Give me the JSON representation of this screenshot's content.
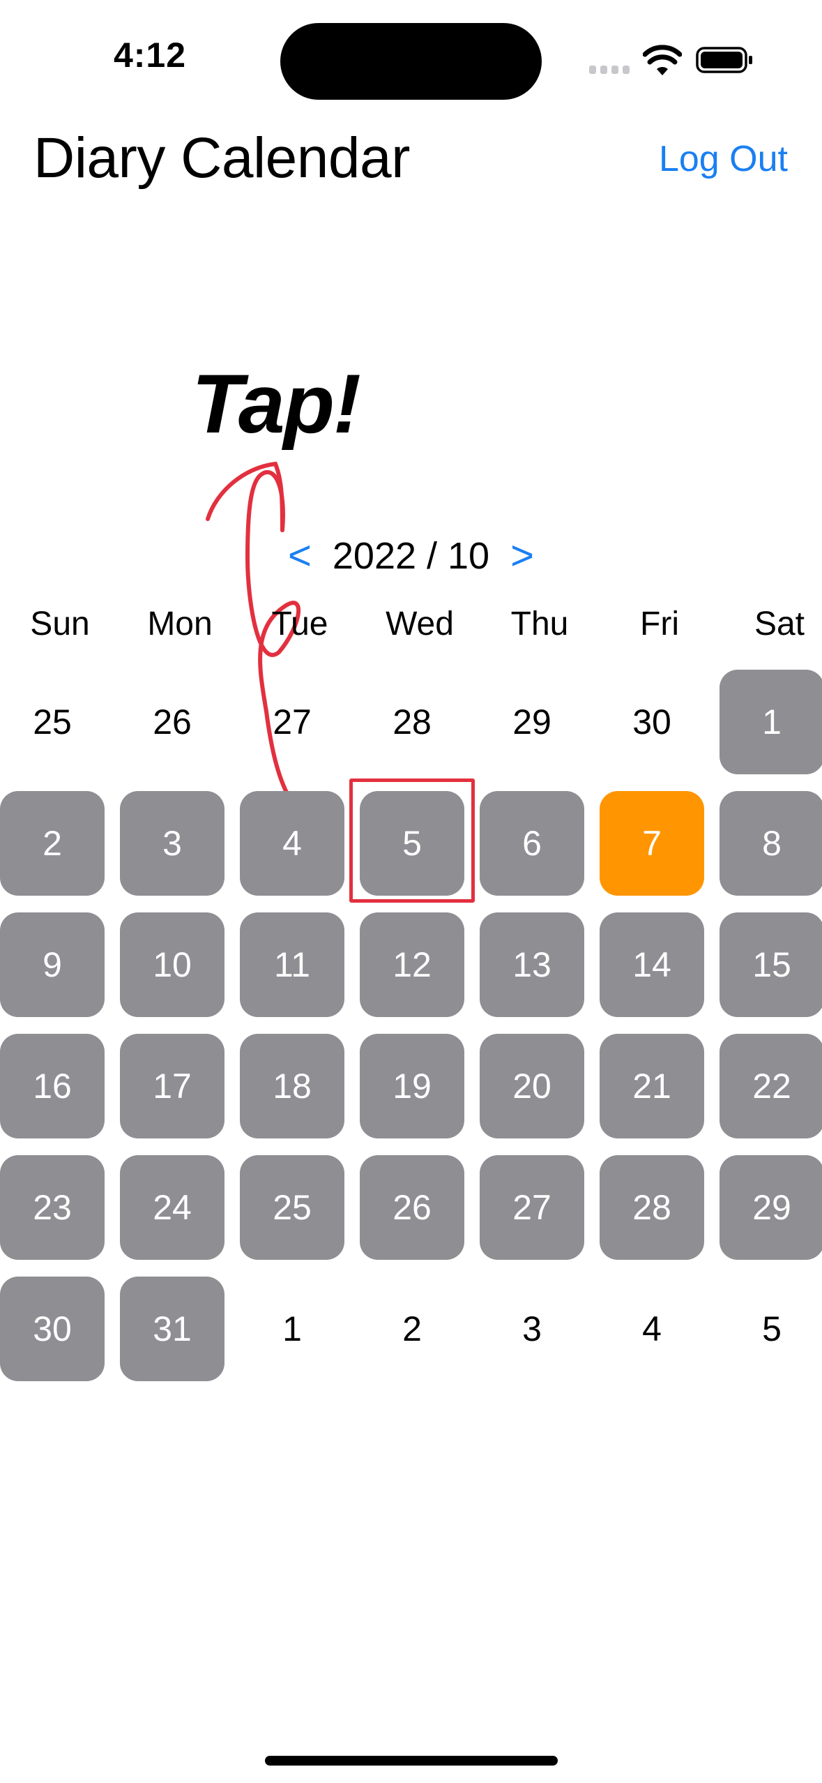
{
  "status_bar": {
    "time": "4:12",
    "icons": [
      "cellular-signal-icon",
      "wifi-icon",
      "battery-icon"
    ]
  },
  "nav": {
    "title": "Diary Calendar",
    "logout_label": "Log Out"
  },
  "annotation": {
    "tap_label": "Tap!",
    "highlight_color": "#e2303f"
  },
  "calendar": {
    "prev_label": "<",
    "month_label": "2022 / 10",
    "next_label": ">",
    "weekdays": [
      "Sun",
      "Mon",
      "Tue",
      "Wed",
      "Thu",
      "Fri",
      "Sat"
    ],
    "days": [
      {
        "label": "25",
        "in_month": false
      },
      {
        "label": "26",
        "in_month": false
      },
      {
        "label": "27",
        "in_month": false
      },
      {
        "label": "28",
        "in_month": false
      },
      {
        "label": "29",
        "in_month": false
      },
      {
        "label": "30",
        "in_month": false
      },
      {
        "label": "1",
        "in_month": true
      },
      {
        "label": "2",
        "in_month": true
      },
      {
        "label": "3",
        "in_month": true
      },
      {
        "label": "4",
        "in_month": true
      },
      {
        "label": "5",
        "in_month": true,
        "highlighted": true
      },
      {
        "label": "6",
        "in_month": true
      },
      {
        "label": "7",
        "in_month": true,
        "today": true
      },
      {
        "label": "8",
        "in_month": true
      },
      {
        "label": "9",
        "in_month": true
      },
      {
        "label": "10",
        "in_month": true
      },
      {
        "label": "11",
        "in_month": true
      },
      {
        "label": "12",
        "in_month": true
      },
      {
        "label": "13",
        "in_month": true
      },
      {
        "label": "14",
        "in_month": true
      },
      {
        "label": "15",
        "in_month": true
      },
      {
        "label": "16",
        "in_month": true
      },
      {
        "label": "17",
        "in_month": true
      },
      {
        "label": "18",
        "in_month": true
      },
      {
        "label": "19",
        "in_month": true
      },
      {
        "label": "20",
        "in_month": true
      },
      {
        "label": "21",
        "in_month": true
      },
      {
        "label": "22",
        "in_month": true
      },
      {
        "label": "23",
        "in_month": true
      },
      {
        "label": "24",
        "in_month": true
      },
      {
        "label": "25",
        "in_month": true
      },
      {
        "label": "26",
        "in_month": true
      },
      {
        "label": "27",
        "in_month": true
      },
      {
        "label": "28",
        "in_month": true
      },
      {
        "label": "29",
        "in_month": true
      },
      {
        "label": "30",
        "in_month": true
      },
      {
        "label": "31",
        "in_month": true
      },
      {
        "label": "1",
        "in_month": false
      },
      {
        "label": "2",
        "in_month": false
      },
      {
        "label": "3",
        "in_month": false
      },
      {
        "label": "4",
        "in_month": false
      },
      {
        "label": "5",
        "in_month": false
      }
    ],
    "colors": {
      "day_active": "#8e8e93",
      "day_today": "#ff9500",
      "accent": "#1a7ff2"
    }
  }
}
